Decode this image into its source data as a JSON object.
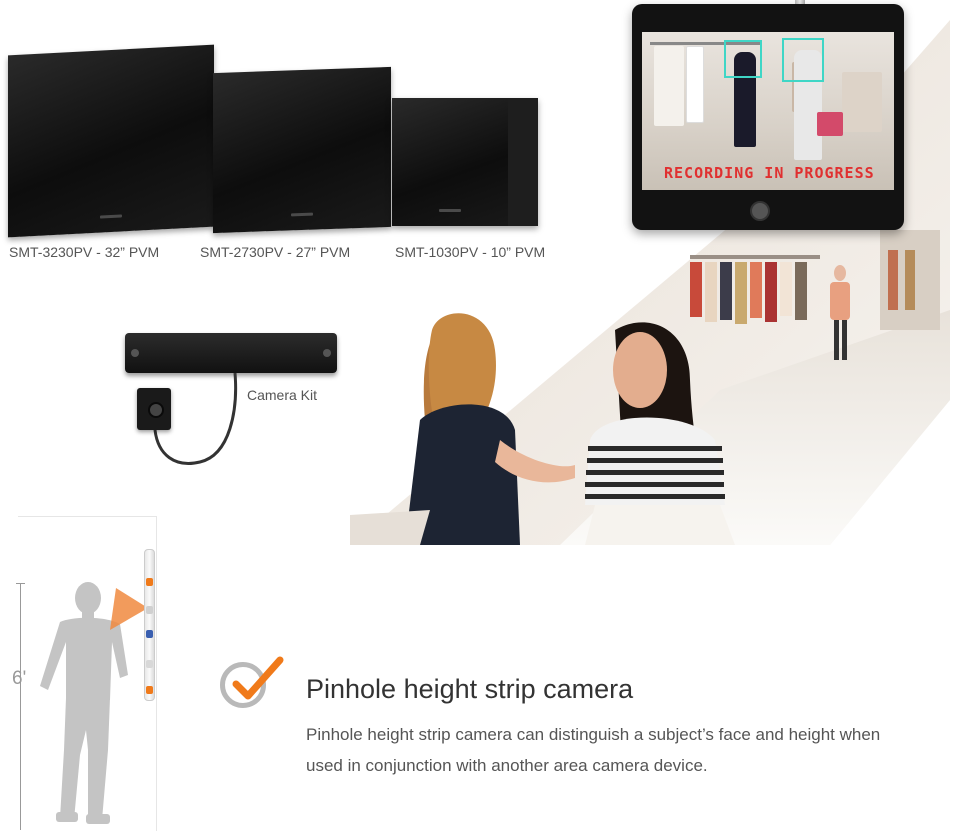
{
  "products": {
    "pvm32": {
      "caption": "SMT-3230PV - 32” PVM"
    },
    "pvm27": {
      "caption": "SMT-2730PV - 27” PVM"
    },
    "pvm10": {
      "caption": "SMT-1030PV - 10” PVM"
    }
  },
  "hanging_monitor": {
    "overlay_text": "RECORDING IN PROGRESS"
  },
  "camera_kit": {
    "label": "Camera Kit"
  },
  "height_strip": {
    "height_label": "6'"
  },
  "feature": {
    "title": "Pinhole height strip camera",
    "description": "Pinhole height strip camera can distinguish a subject’s face and height when used in conjunction with another area camera device."
  },
  "colors": {
    "accent_orange": "#f07a1a",
    "facebox_teal": "#3fd6c6",
    "recording_red": "#e03030"
  }
}
